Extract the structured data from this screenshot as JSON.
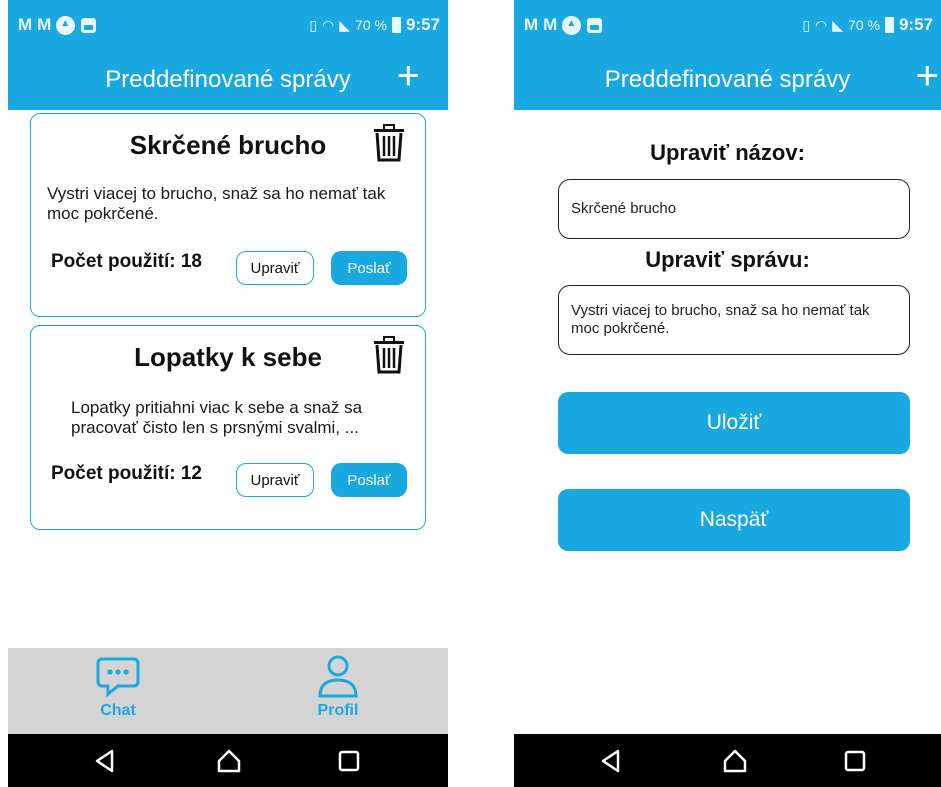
{
  "status_bar": {
    "left_icons": [
      "gmail-icon",
      "gmail-icon",
      "app-icon",
      "image-icon"
    ],
    "battery": "70 %",
    "time": "9:57"
  },
  "app_bar": {
    "title": "Preddefinované správy",
    "add_label": "+"
  },
  "messages": [
    {
      "title": "Skrčené brucho",
      "text": "Vystri viacej to brucho, snaž sa ho nemať tak moc pokrčené.",
      "count_label": "Počet použití: 18",
      "edit_label": "Upraviť",
      "send_label": "Poslať"
    },
    {
      "title": "Lopatky k sebe",
      "text": "Lopatky pritiahni viac k sebe a snaž sa pracovať čisto len s prsnými svalmi, ...",
      "count_label": "Počet použití: 12",
      "edit_label": "Upraviť",
      "send_label": "Poslať"
    }
  ],
  "tabs": {
    "chat": "Chat",
    "profil": "Profil"
  },
  "edit_screen": {
    "name_label": "Upraviť názov:",
    "name_value": "Skrčené brucho",
    "message_label": "Upraviť správu:",
    "message_value": "Vystri viacej to brucho, snaž sa ho nemať tak moc pokrčené.",
    "save_label": "Uložiť",
    "back_label": "Naspäť"
  },
  "colors": {
    "accent": "#1aa8e0",
    "tab_bar": "#d4d4d4",
    "nav_bar": "#000000"
  }
}
